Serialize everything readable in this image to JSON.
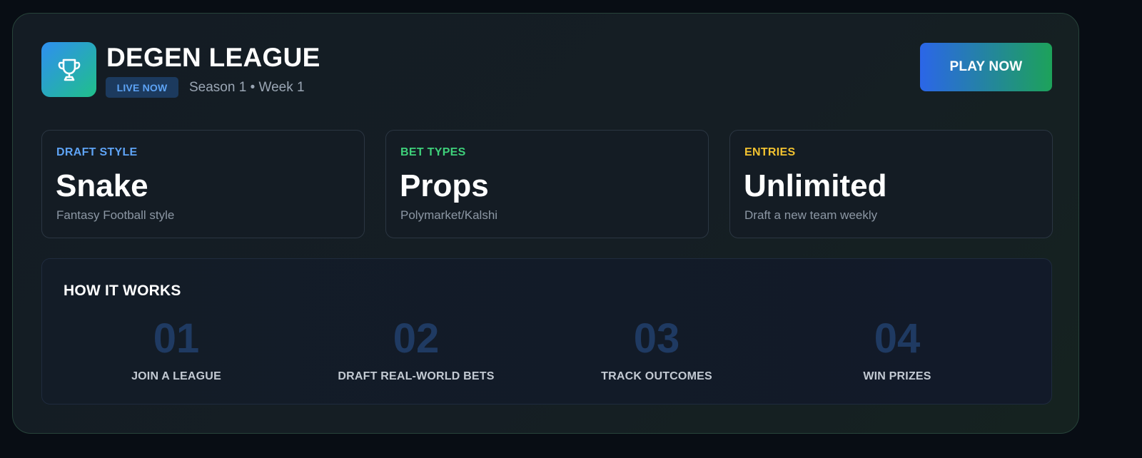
{
  "header": {
    "logo_icon": "trophy-icon",
    "title": "DEGEN LEAGUE",
    "badge": "LIVE NOW",
    "season": "Season 1 • Week 1",
    "play_button": "PLAY NOW"
  },
  "stats": [
    {
      "label": "DRAFT STYLE",
      "value": "Snake",
      "sub": "Fantasy Football style",
      "color": "#5ea3f5"
    },
    {
      "label": "BET TYPES",
      "value": "Props",
      "sub": "Polymarket/Kalshi",
      "color": "#3ed07a"
    },
    {
      "label": "ENTRIES",
      "value": "Unlimited",
      "sub": "Draft a new team weekly",
      "color": "#f2c230"
    }
  ],
  "how_it_works": {
    "title": "HOW IT WORKS",
    "steps": [
      {
        "number": "01",
        "label": "JOIN A LEAGUE"
      },
      {
        "number": "02",
        "label": "DRAFT REAL-WORLD BETS"
      },
      {
        "number": "03",
        "label": "TRACK OUTCOMES"
      },
      {
        "number": "04",
        "label": "WIN PRIZES"
      }
    ]
  },
  "colors": {
    "accent_blue": "#2b66e8",
    "accent_green": "#1da25a",
    "step_number": "#1f3a62"
  }
}
